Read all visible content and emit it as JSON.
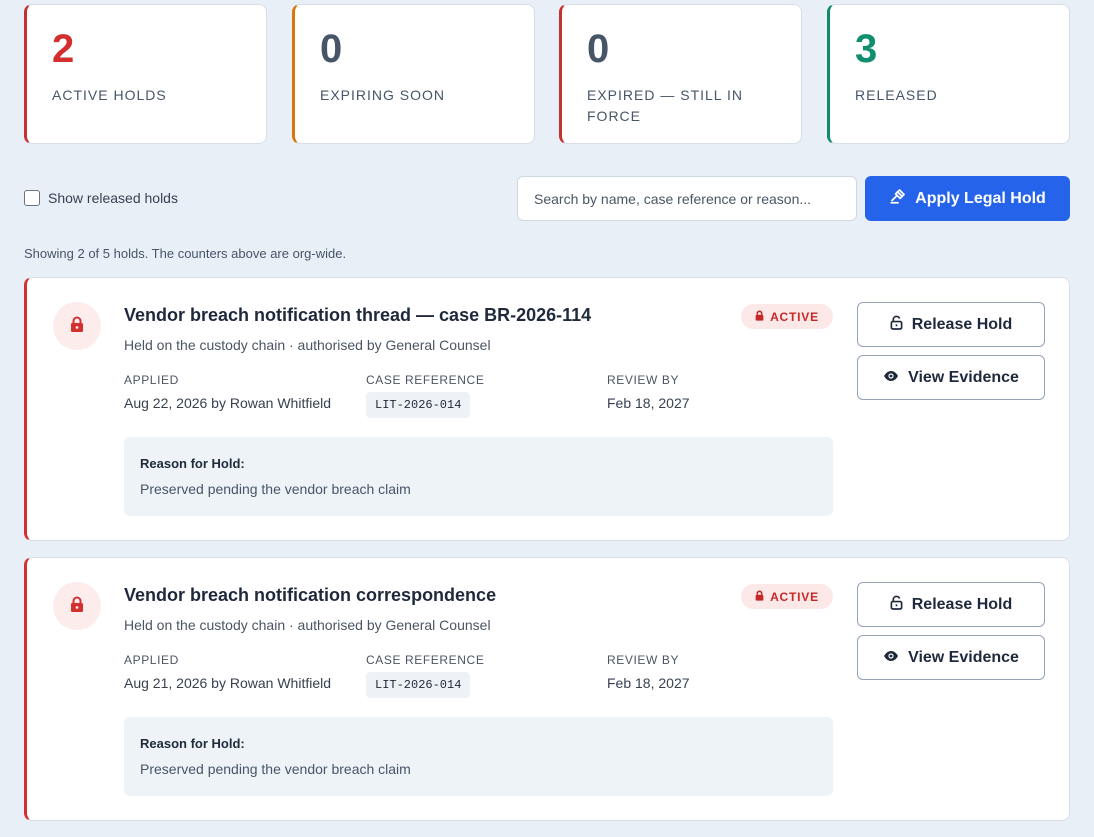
{
  "stats": [
    {
      "value": "2",
      "label": "ACTIVE HOLDS"
    },
    {
      "value": "0",
      "label": "EXPIRING SOON"
    },
    {
      "value": "0",
      "label": "EXPIRED — STILL IN FORCE"
    },
    {
      "value": "3",
      "label": "RELEASED"
    }
  ],
  "toolbar": {
    "show_released_label": "Show released holds",
    "show_released_checked": false,
    "search_placeholder": "Search by name, case reference or reason...",
    "apply_label": "Apply Legal Hold"
  },
  "summary": "Showing 2 of 5 holds. The counters above are org-wide.",
  "meta_labels": {
    "applied": "APPLIED",
    "case_reference": "CASE REFERENCE",
    "review_by": "REVIEW BY"
  },
  "reason_label": "Reason for Hold:",
  "holds": [
    {
      "title": "Vendor breach notification thread — case BR-2026-114",
      "subtitle": "Held on the custody chain · authorised by General Counsel",
      "status": "ACTIVE",
      "applied": "Aug 22, 2026 by Rowan Whitfield",
      "case_reference": "LIT-2026-014",
      "review_by": "Feb 18, 2027",
      "reason": "Preserved pending the vendor breach claim",
      "release_label": "Release Hold",
      "evidence_label": "View Evidence"
    },
    {
      "title": "Vendor breach notification correspondence",
      "subtitle": "Held on the custody chain · authorised by General Counsel",
      "status": "ACTIVE",
      "applied": "Aug 21, 2026 by Rowan Whitfield",
      "case_reference": "LIT-2026-014",
      "review_by": "Feb 18, 2027",
      "reason": "Preserved pending the vendor breach claim",
      "release_label": "Release Hold",
      "evidence_label": "View Evidence"
    }
  ],
  "colors": {
    "active_red": "#d32f2f",
    "expiring_orange": "#d97706",
    "released_green": "#0f8f6e",
    "primary_blue": "#2563eb"
  },
  "icons": {
    "apply": "gavel-icon",
    "hold": "lock-icon",
    "badge": "lock-icon",
    "release": "unlock-icon",
    "evidence": "eye-icon"
  }
}
